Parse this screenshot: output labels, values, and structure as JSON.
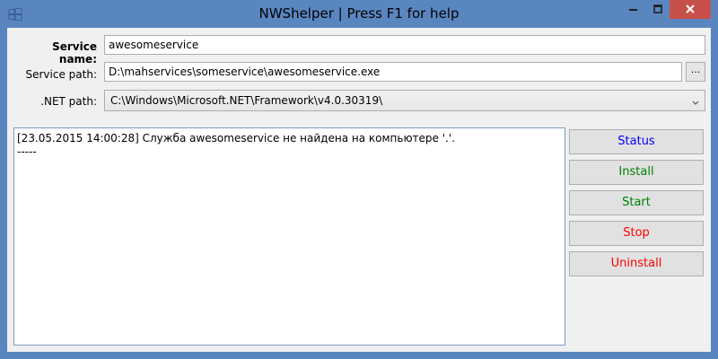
{
  "window": {
    "title": "NWShelper | Press F1 for help",
    "icon": "windows-logo-icon",
    "controls": [
      "minimize-icon",
      "maximize-icon",
      "close-icon"
    ]
  },
  "form": {
    "service_name_label": "Service name:",
    "service_name_value": "awesomeservice",
    "service_path_label": "Service path:",
    "service_path_value": "D:\\mahservices\\someservice\\awesomeservice.exe",
    "browse_label": "...",
    "net_path_label": ".NET path:",
    "net_path_value": "C:\\Windows\\Microsoft.NET\\Framework\\v4.0.30319\\"
  },
  "log": {
    "lines": [
      "[23.05.2015 14:00:28] Служба awesomeservice не найдена на компьютере '.'.",
      "-----"
    ]
  },
  "actions": [
    {
      "label": "Status",
      "color": "#0000ff"
    },
    {
      "label": "Install",
      "color": "#008000"
    },
    {
      "label": "Start",
      "color": "#008000"
    },
    {
      "label": "Stop",
      "color": "#ff0000"
    },
    {
      "label": "Uninstall",
      "color": "#ff0000"
    }
  ],
  "colors": {
    "frame": "#5a86c0",
    "close_button": "#c7504a",
    "log_border": "#7a9cc8"
  }
}
